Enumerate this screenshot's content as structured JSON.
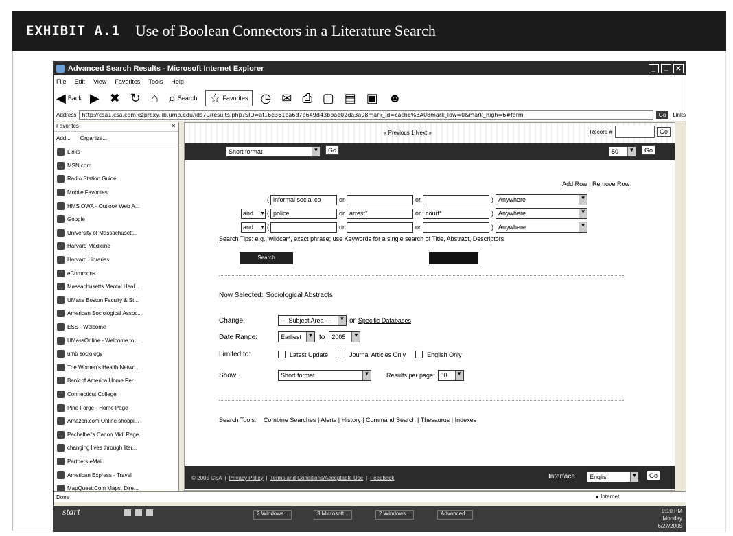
{
  "exhibit": {
    "label": "EXHIBIT A.1",
    "title": "Use of Boolean Connectors in a Literature Search"
  },
  "browser": {
    "title": "Advanced Search Results - Microsoft Internet Explorer",
    "menu": [
      "File",
      "Edit",
      "View",
      "Favorites",
      "Tools",
      "Help"
    ],
    "toolbar": {
      "back": "Back",
      "search": "Search",
      "favorites": "Favorites"
    },
    "address_label": "Address",
    "address": "http://csa1.csa.com.ezproxy.lib.umb.edu/ids70/results.php?SID=af16e361ba6d7b649d43bbae02da3a08mark_id=cache%3A08mark_low=0&mark_high=6#form",
    "go": "Go",
    "links": "Links",
    "status": "Done",
    "zone": "Internet"
  },
  "favorites": {
    "header": "Favorites",
    "add": "Add...",
    "organize": "Organize...",
    "items": [
      "Links",
      "MSN.com",
      "Radio Station Guide",
      "Mobile Favorites",
      "HMS OWA - Outlook Web A...",
      "Google",
      "University of Massachusett...",
      "Harvard Medicine",
      "Harvard Libraries",
      "eCommons",
      "Massachusetts Mental Heal...",
      "UMass Boston Faculty & St...",
      "American Sociological Assoc...",
      "ESS - Welcome",
      "UMassOnline - Welcome to ...",
      "umb sociology",
      "The Women's Health Netwo...",
      "Bank of America Home Per...",
      "Connecticut College",
      "Pine Forge - Home Page",
      "Amazon.com Online shoppi...",
      "Pachelbel's Canon Midi Page",
      "changing lives through liter...",
      "Partners eMail",
      "American Express - Travel",
      "MapQuest.Com Maps, Dire..."
    ]
  },
  "search": {
    "pager": "« Previous 1 Next »",
    "record_label": "Record #",
    "go": "Go",
    "format": "Short format",
    "per_page": "50",
    "add_row": "Add Row",
    "remove_row": "Remove Row",
    "rows": [
      {
        "bool": "",
        "t1": "informal social co",
        "t2": "",
        "t3": "",
        "where": "Anywhere"
      },
      {
        "bool": "and",
        "t1": "police",
        "t2": "arrest*",
        "t3": "court*",
        "where": "Anywhere"
      },
      {
        "bool": "and",
        "t1": "",
        "t2": "",
        "t3": "",
        "where": "Anywhere"
      }
    ],
    "or": "or",
    "tips_label": "Search Tips:",
    "tips_text": "e.g., wildcar*, exact phrase; use Keywords for a single search of Title, Abstract, Descriptors",
    "search_button": "Search",
    "now_selected_label": "Now Selected:",
    "now_selected_value": "Sociological Abstracts",
    "change_label": "Change:",
    "subject_area": "--- Subject Area ---",
    "or_word": "or",
    "specific_databases": "Specific Databases",
    "date_range_label": "Date Range:",
    "date_from": "Earliest",
    "date_to_word": "to",
    "date_to": "2005",
    "limited_label": "Limited to:",
    "limit_latest": "Latest Update",
    "limit_journal": "Journal Articles Only",
    "limit_english": "English Only",
    "show_label": "Show:",
    "show_value": "Short format",
    "results_per_page_label": "Results per page:",
    "results_per_page": "50",
    "tools_label": "Search Tools:",
    "tools": [
      "Combine Searches",
      "Alerts",
      "History",
      "Command Search",
      "Thesaurus",
      "Indexes"
    ],
    "footer_copy": "© 2005 CSA",
    "footer_links": [
      "Privacy Policy",
      "Terms and Conditions/Acceptable Use",
      "Feedback"
    ],
    "interface_label": "Interface",
    "interface_value": "English"
  },
  "taskbar": {
    "start": "start",
    "tasks": [
      "2 Windows...",
      "3 Microsoft...",
      "2 Windows...",
      "Advanced..."
    ],
    "clock": [
      "9:10 PM",
      "Monday",
      "6/27/2005"
    ]
  }
}
